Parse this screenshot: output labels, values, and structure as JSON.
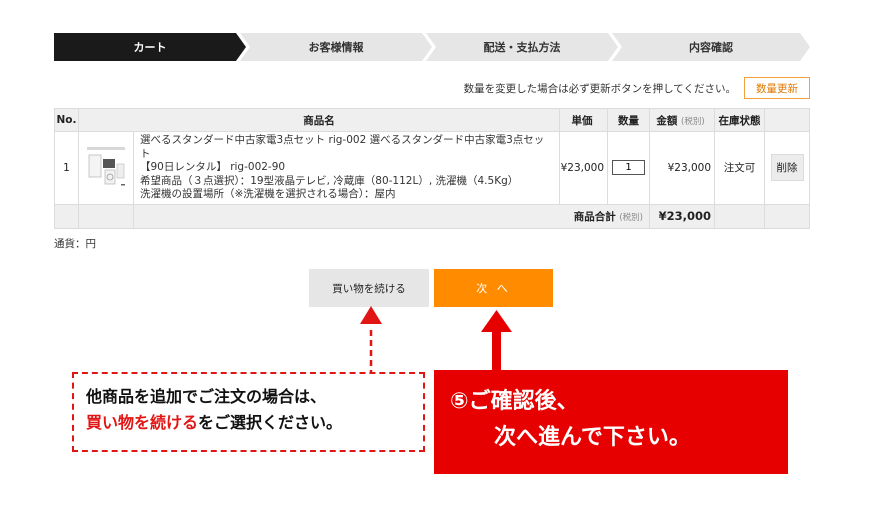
{
  "steps": [
    "カート",
    "お客様情報",
    "配送・支払方法",
    "内容確認"
  ],
  "notice": "数量を変更した場合は必ず更新ボタンを押してください。",
  "update_button": "数量更新",
  "table": {
    "headers": {
      "no": "No.",
      "product": "商品名",
      "price": "単価",
      "qty": "数量",
      "amount": "金額",
      "amount_tax": "(税別)",
      "stock": "在庫状態"
    },
    "rows": [
      {
        "no": "1",
        "name_line1": "選べるスタンダード中古家電3点セット rig-002 選べるスタンダード中古家電3点セット",
        "name_line2": "【90日レンタル】 rig-002-90",
        "option_line1": "希望商品（３点選択）：19型液晶テレビ, 冷蔵庫（80-112L）, 洗濯機（4.5Kg）",
        "option_line2": "洗濯機の設置場所（※洗濯機を選択される場合）：屋内",
        "price": "¥23,000",
        "qty": "1",
        "amount": "¥23,000",
        "stock": "注文可",
        "delete": "削除"
      }
    ],
    "total_label": "商品合計",
    "total_tax": "(税別)",
    "total_value": "¥23,000"
  },
  "currency": "通貨：円",
  "continue_button": "買い物を続ける",
  "next_button": "次 へ",
  "callout_left": {
    "line1": "他商品を追加でご注文の場合は、",
    "highlight": "買い物を続ける",
    "line2_rest": "をご選択ください。"
  },
  "callout_right": {
    "line1": "⑤ご確認後、",
    "line2": "次へ進んで下さい。"
  },
  "colors": {
    "accent_orange": "#ff8c00",
    "callout_red": "#e60000",
    "step_active": "#1a1a1a"
  }
}
